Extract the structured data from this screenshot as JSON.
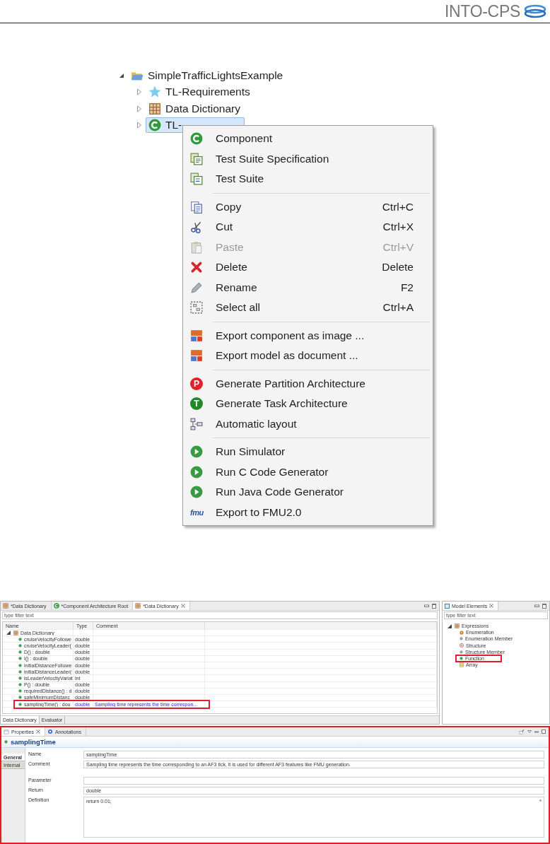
{
  "header": {
    "logo_text": "INTO-CPS"
  },
  "project_tree": {
    "root": {
      "label": "SimpleTrafficLightsExample",
      "kind": "folder",
      "expanded": true,
      "children": [
        {
          "label": "TL-Requirements",
          "kind": "requirements",
          "expanded": false,
          "selected": false
        },
        {
          "label": "Data Dictionary",
          "kind": "dictionary",
          "expanded": false,
          "selected": false
        },
        {
          "label": "TL-",
          "kind": "component",
          "expanded": false,
          "selected": true
        }
      ]
    }
  },
  "context_menu": {
    "groups": [
      [
        {
          "kind": "component",
          "label": "Component",
          "disabled": false
        },
        {
          "kind": "test-spec",
          "label": "Test Suite Specification",
          "disabled": false
        },
        {
          "kind": "test-suite",
          "label": "Test Suite",
          "disabled": false
        }
      ],
      [
        {
          "kind": "copy",
          "label": "Copy",
          "shortcut": "Ctrl+C",
          "disabled": false
        },
        {
          "kind": "cut",
          "label": "Cut",
          "shortcut": "Ctrl+X",
          "disabled": false
        },
        {
          "kind": "paste",
          "label": "Paste",
          "shortcut": "Ctrl+V",
          "disabled": true
        },
        {
          "kind": "delete",
          "label": "Delete",
          "shortcut": "Delete",
          "disabled": false
        },
        {
          "kind": "rename",
          "label": "Rename",
          "shortcut": "F2",
          "disabled": false
        },
        {
          "kind": "select-all",
          "label": "Select all",
          "shortcut": "Ctrl+A",
          "disabled": false
        }
      ],
      [
        {
          "kind": "export",
          "label": "Export component as image ...",
          "disabled": false
        },
        {
          "kind": "export",
          "label": "Export model as document ...",
          "disabled": false
        }
      ],
      [
        {
          "kind": "letter",
          "badge": "P",
          "color": "#e0202a",
          "label": "Generate Partition Architecture",
          "disabled": false
        },
        {
          "kind": "letter",
          "badge": "T",
          "color": "#1f8a2a",
          "label": "Generate Task Architecture",
          "disabled": false
        },
        {
          "kind": "layout",
          "label": "Automatic layout",
          "disabled": false
        }
      ],
      [
        {
          "kind": "run",
          "label": "Run Simulator",
          "disabled": false
        },
        {
          "kind": "run",
          "label": "Run C Code Generator",
          "disabled": false
        },
        {
          "kind": "run",
          "label": "Run Java Code Generator",
          "disabled": false
        },
        {
          "kind": "fmu",
          "badge": "fmu",
          "label": "Export to FMU2.0",
          "disabled": false
        }
      ]
    ]
  },
  "editor": {
    "tabs": [
      {
        "kind": "dictionary",
        "label": "*Data Dictionary",
        "selected": false
      },
      {
        "kind": "component",
        "label": "*Component Architecture Root",
        "selected": false
      },
      {
        "kind": "dictionary",
        "label": "*Data Dictionary",
        "selected": true
      }
    ],
    "filter": {
      "placeholder": "type filter text"
    },
    "table": {
      "columns": [
        "Name",
        "Type",
        "Comment"
      ],
      "root": {
        "label": "Data Dictionary",
        "expanded": true
      },
      "rows": [
        {
          "name": "cruiseVelocityFollowe",
          "type": "double",
          "marked": false
        },
        {
          "name": "cruiseVelocityLeader(",
          "type": "double",
          "marked": false
        },
        {
          "name": "D() : double",
          "type": "double",
          "marked": false
        },
        {
          "name": "I() : double",
          "type": "double",
          "marked": false
        },
        {
          "name": "initialDistanceFollowe",
          "type": "double",
          "marked": false
        },
        {
          "name": "initialDistanceLeader(",
          "type": "double",
          "marked": false
        },
        {
          "name": "isLeaderVelocityVariat",
          "type": "int",
          "marked": false
        },
        {
          "name": "P() : double",
          "type": "double",
          "marked": false
        },
        {
          "name": "requiredDistance() : d",
          "type": "double",
          "marked": false
        },
        {
          "name": "safeMinimumDistanc",
          "type": "double",
          "marked": false
        },
        {
          "name": "samplingTime() : dou",
          "type": "double",
          "comment": "Sampling time represents the time correspon...",
          "marked": true
        }
      ]
    },
    "bottom_tabs": [
      {
        "label": "Data Dictionary",
        "selected": true
      },
      {
        "label": "Evaluator",
        "selected": false
      }
    ]
  },
  "model_elements": {
    "title": "Model Elements",
    "filter": {
      "placeholder": "type filter text"
    },
    "tree": {
      "label": "Expressions",
      "expanded": true,
      "children": [
        {
          "kind": "enumeration",
          "label": "Enumeration",
          "marked": false
        },
        {
          "kind": "member",
          "label": "Enumeration Member",
          "marked": false
        },
        {
          "kind": "structure",
          "label": "Structure",
          "marked": false
        },
        {
          "kind": "member",
          "label": "Structure Member",
          "marked": false
        },
        {
          "kind": "function",
          "label": "Function",
          "marked": true
        },
        {
          "kind": "array",
          "label": "Array",
          "marked": false
        }
      ]
    }
  },
  "properties": {
    "marked": true,
    "tabs": [
      {
        "kind": "properties",
        "label": "Properties",
        "selected": true
      },
      {
        "kind": "annotations",
        "label": "Annotations",
        "selected": false
      }
    ],
    "title": "samplingTime",
    "side_tabs": [
      {
        "label": "General",
        "selected": true
      },
      {
        "label": "Internal",
        "selected": false
      }
    ],
    "fields": [
      {
        "kind": "line",
        "label": "Name",
        "value": "samplingTime"
      },
      {
        "kind": "line",
        "label": "Comment",
        "value": "Sampling time represents the time corresponding to an AF3 tick, it is used for different AF3 features like FMU generation."
      },
      {
        "kind": "gap"
      },
      {
        "kind": "line",
        "label": "Parameter"
      },
      {
        "kind": "line",
        "label": "Return",
        "value": "double"
      },
      {
        "kind": "area",
        "label": "Definition",
        "value": "return 0.01;"
      }
    ]
  }
}
